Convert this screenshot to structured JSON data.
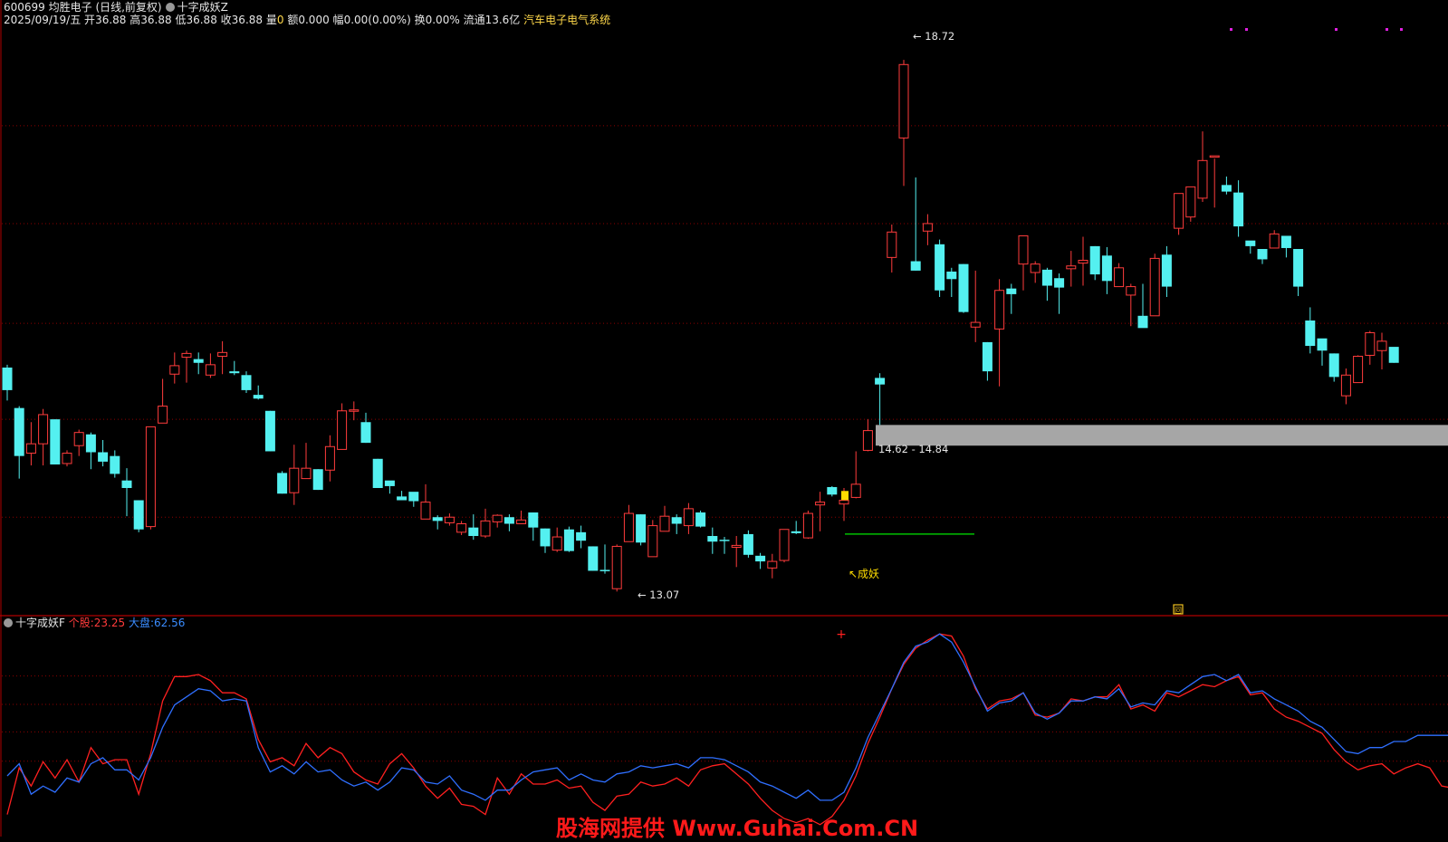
{
  "header": {
    "code_name": "600699 均胜电子 (日线,前复权)",
    "indicator_name": "十字成妖Z",
    "date_weekday": "2025/09/19/五",
    "open_label": "开",
    "open": "36.88",
    "high_label": "高",
    "high": "36.88",
    "low_label": "低",
    "low": "36.88",
    "close_label": "收",
    "close": "36.88",
    "vol_label": "量",
    "vol": "0",
    "amount_label": "额",
    "amount": "0.000",
    "change_label": "幅",
    "change": "0.00(0.00%)",
    "turnover_label": "换",
    "turnover": "0.00%",
    "float_label": "流通",
    "float_cap": "13.6亿",
    "sector": "汽车电子电气系统"
  },
  "annotations": {
    "high_label": "18.72",
    "low_label": "13.07",
    "zone_label": "14.62 - 14.84",
    "signal_label": "成妖",
    "panel_marker": "回"
  },
  "indicator_header": {
    "name": "十字成妖F",
    "stock_label": "个股:",
    "stock_value": "23.25",
    "market_label": "大盘:",
    "market_value": "62.56"
  },
  "watermark": "股海网提供 Www.Guhai.Com.CN",
  "colors": {
    "up": "#ff3c3c",
    "down": "#54f0f0",
    "zone": "#a6a6a6",
    "support_line": "#00c000",
    "signal": "#ffdd00",
    "stock_line": "#ff2020",
    "market_line": "#2f6fff",
    "grid": "#8b0000",
    "frame": "#b00000",
    "dots": "#e020e0"
  },
  "chart_data": [
    {
      "type": "candlestick",
      "price_range": [
        12.9,
        19.0
      ],
      "y_grid": [
        18.02,
        16.98,
        15.92,
        14.9,
        13.86
      ],
      "candles": [
        [
          15.45,
          15.21,
          15.48,
          15.1
        ],
        [
          15.02,
          14.51,
          15.04,
          14.27
        ],
        [
          14.54,
          14.64,
          14.87,
          14.41
        ],
        [
          14.64,
          14.95,
          15.01,
          14.41
        ],
        [
          14.9,
          14.42,
          14.9,
          14.42
        ],
        [
          14.43,
          14.54,
          14.57,
          14.4
        ],
        [
          14.62,
          14.76,
          14.79,
          14.51
        ],
        [
          14.74,
          14.55,
          14.76,
          14.37
        ],
        [
          14.55,
          14.45,
          14.68,
          14.4
        ],
        [
          14.51,
          14.32,
          14.57,
          14.28
        ],
        [
          14.25,
          14.17,
          14.38,
          13.87
        ],
        [
          14.04,
          13.73,
          14.04,
          13.7
        ],
        [
          13.76,
          14.82,
          14.82,
          13.73
        ],
        [
          14.86,
          15.04,
          15.33,
          14.86
        ],
        [
          15.38,
          15.47,
          15.61,
          15.28
        ],
        [
          15.56,
          15.6,
          15.63,
          15.29
        ],
        [
          15.54,
          15.5,
          15.61,
          15.38
        ],
        [
          15.37,
          15.48,
          15.6,
          15.34
        ],
        [
          15.57,
          15.61,
          15.73,
          15.38
        ],
        [
          15.41,
          15.39,
          15.52,
          15.37
        ],
        [
          15.37,
          15.21,
          15.41,
          15.18
        ],
        [
          15.16,
          15.12,
          15.26,
          15.11
        ],
        [
          14.99,
          14.56,
          14.99,
          14.56
        ],
        [
          14.33,
          14.11,
          14.35,
          14.11
        ],
        [
          14.12,
          14.38,
          14.63,
          13.99
        ],
        [
          14.27,
          14.38,
          14.65,
          14.27
        ],
        [
          14.37,
          14.15,
          14.37,
          14.15
        ],
        [
          14.36,
          14.61,
          14.73,
          14.24
        ],
        [
          14.58,
          14.99,
          15.07,
          14.58
        ],
        [
          14.99,
          15.0,
          15.09,
          14.89
        ],
        [
          14.87,
          14.65,
          14.97,
          14.65
        ],
        [
          14.48,
          14.17,
          14.48,
          14.17
        ],
        [
          14.25,
          14.19,
          14.24,
          14.11
        ],
        [
          14.08,
          14.04,
          14.14,
          14.06
        ],
        [
          14.13,
          14.03,
          14.1,
          13.97
        ],
        [
          13.84,
          14.02,
          14.21,
          13.84
        ],
        [
          13.86,
          13.82,
          13.88,
          13.73
        ],
        [
          13.8,
          13.86,
          13.9,
          13.77
        ],
        [
          13.7,
          13.79,
          13.82,
          13.67
        ],
        [
          13.75,
          13.66,
          13.89,
          13.62
        ],
        [
          13.66,
          13.82,
          13.95,
          13.64
        ],
        [
          13.81,
          13.88,
          13.89,
          13.75
        ],
        [
          13.86,
          13.79,
          13.89,
          13.71
        ],
        [
          13.79,
          13.83,
          13.93,
          13.79
        ],
        [
          13.91,
          13.75,
          13.91,
          13.61
        ],
        [
          13.74,
          13.55,
          13.74,
          13.48
        ],
        [
          13.51,
          13.65,
          13.75,
          13.49
        ],
        [
          13.73,
          13.5,
          13.76,
          13.49
        ],
        [
          13.7,
          13.61,
          13.77,
          13.53
        ],
        [
          13.55,
          13.29,
          13.55,
          13.29
        ],
        [
          13.3,
          13.29,
          13.57,
          13.26
        ],
        [
          13.1,
          13.55,
          13.57,
          13.07
        ],
        [
          13.6,
          13.9,
          13.99,
          13.6
        ],
        [
          13.89,
          13.59,
          13.89,
          13.56
        ],
        [
          13.44,
          13.77,
          13.83,
          13.44
        ],
        [
          13.71,
          13.87,
          13.98,
          13.71
        ],
        [
          13.86,
          13.79,
          13.89,
          13.68
        ],
        [
          13.77,
          13.95,
          14.01,
          13.68
        ],
        [
          13.91,
          13.76,
          13.93,
          13.75
        ],
        [
          13.66,
          13.6,
          13.75,
          13.47
        ],
        [
          13.62,
          13.61,
          13.65,
          13.47
        ],
        [
          13.54,
          13.56,
          13.66,
          13.33
        ],
        [
          13.68,
          13.46,
          13.72,
          13.43
        ],
        [
          13.45,
          13.39,
          13.48,
          13.31
        ],
        [
          13.32,
          13.39,
          13.47,
          13.21
        ],
        [
          13.4,
          13.73,
          13.73,
          13.38
        ],
        [
          13.71,
          13.69,
          13.82,
          13.68
        ],
        [
          13.64,
          13.9,
          13.93,
          13.63
        ],
        [
          13.99,
          14.02,
          14.13,
          13.71
        ],
        [
          14.18,
          14.1,
          14.19,
          14.08
        ],
        [
          14.0,
          14.04,
          14.17,
          13.82
        ],
        [
          14.07,
          14.21,
          14.56,
          14.06
        ],
        [
          14.57,
          14.78,
          14.9,
          14.56
        ],
        [
          15.34,
          15.27,
          15.39,
          14.84
        ],
        [
          16.62,
          16.89,
          16.97,
          16.46
        ],
        [
          17.89,
          18.67,
          18.72,
          17.38
        ],
        [
          16.58,
          16.48,
          17.47,
          16.48
        ],
        [
          16.9,
          16.98,
          17.08,
          16.75
        ],
        [
          16.76,
          16.27,
          16.81,
          16.2
        ],
        [
          16.47,
          16.39,
          16.51,
          16.2
        ],
        [
          16.55,
          16.04,
          16.55,
          16.03
        ],
        [
          15.88,
          15.93,
          16.48,
          15.72
        ],
        [
          15.72,
          15.41,
          15.72,
          15.31
        ],
        [
          15.86,
          16.27,
          16.39,
          15.25
        ],
        [
          16.29,
          16.23,
          16.34,
          16.02
        ],
        [
          16.55,
          16.85,
          16.81,
          16.27
        ],
        [
          16.46,
          16.55,
          16.58,
          16.35
        ],
        [
          16.49,
          16.32,
          16.51,
          16.16
        ],
        [
          16.4,
          16.3,
          16.45,
          16.02
        ],
        [
          16.5,
          16.53,
          16.69,
          16.31
        ],
        [
          16.56,
          16.59,
          16.84,
          16.32
        ],
        [
          16.74,
          16.44,
          16.74,
          16.38
        ],
        [
          16.64,
          16.37,
          16.73,
          16.23
        ],
        [
          16.31,
          16.51,
          16.56,
          16.42
        ],
        [
          16.22,
          16.31,
          16.34,
          15.89
        ],
        [
          16.0,
          15.87,
          16.34,
          15.89
        ],
        [
          16.0,
          16.61,
          16.66,
          16.0
        ],
        [
          16.65,
          16.31,
          16.74,
          16.2
        ],
        [
          16.93,
          17.3,
          17.3,
          16.86
        ],
        [
          17.05,
          17.37,
          17.35,
          17.0
        ],
        [
          17.25,
          17.65,
          17.96,
          17.21
        ],
        [
          17.7,
          17.7,
          17.67,
          17.15
        ],
        [
          17.39,
          17.32,
          17.48,
          17.29
        ],
        [
          17.31,
          16.95,
          17.44,
          16.84
        ],
        [
          16.8,
          16.74,
          16.77,
          16.66
        ],
        [
          16.71,
          16.6,
          16.71,
          16.55
        ],
        [
          16.72,
          16.87,
          16.91,
          16.72
        ],
        [
          16.85,
          16.72,
          16.83,
          16.62
        ],
        [
          16.71,
          16.31,
          16.71,
          16.21
        ],
        [
          15.95,
          15.68,
          16.09,
          15.6
        ],
        [
          15.76,
          15.63,
          15.73,
          15.47
        ],
        [
          15.6,
          15.35,
          15.6,
          15.3
        ],
        [
          15.15,
          15.37,
          15.44,
          15.06
        ],
        [
          15.29,
          15.57,
          15.58,
          15.29
        ],
        [
          15.58,
          15.82,
          15.84,
          15.48
        ],
        [
          15.63,
          15.73,
          15.82,
          15.43
        ],
        [
          15.67,
          15.5,
          15.63,
          15.5
        ]
      ]
    },
    {
      "type": "line",
      "y_range": [
        0,
        100
      ],
      "y_grid": [
        78.3,
        64.3,
        50.7,
        36.3
      ],
      "series": [
        {
          "name": "个股",
          "values": [
            10,
            33,
            24,
            36,
            28,
            37,
            26,
            43,
            35,
            37,
            37,
            20,
            40,
            66,
            78,
            78,
            79,
            76,
            70,
            70,
            67,
            47,
            36,
            38,
            34,
            45,
            38,
            43,
            40,
            31,
            27,
            25,
            35,
            40,
            33,
            24,
            18,
            23,
            15,
            14,
            10,
            28,
            20,
            30,
            25,
            25,
            27,
            23,
            24,
            16,
            12,
            19,
            20,
            26,
            24,
            25,
            28,
            24,
            32,
            34,
            35,
            30,
            25,
            18,
            12,
            8,
            6,
            8,
            5,
            9,
            17,
            29,
            45,
            58,
            72,
            84,
            92,
            96,
            99,
            98,
            88,
            72,
            62,
            66,
            67,
            70,
            59,
            58,
            60,
            67,
            66,
            68,
            68,
            74,
            62,
            64,
            61,
            70,
            68,
            71,
            74,
            73,
            76,
            78,
            69,
            70,
            62,
            58,
            56,
            53,
            50,
            42,
            36,
            32,
            34,
            35,
            30,
            33,
            35,
            33,
            24,
            23
          ]
        },
        {
          "name": "大盘",
          "values": [
            29,
            35,
            20,
            24,
            21,
            28,
            26,
            35,
            38,
            32,
            32,
            27,
            38,
            53,
            64,
            68,
            72,
            71,
            66,
            67,
            66,
            43,
            31,
            34,
            30,
            36,
            31,
            32,
            27,
            24,
            26,
            22,
            26,
            33,
            32,
            26,
            25,
            29,
            22,
            20,
            17,
            22,
            22,
            27,
            31,
            32,
            33,
            27,
            30,
            27,
            26,
            30,
            31,
            34,
            33,
            34,
            35,
            33,
            38,
            38,
            37,
            34,
            31,
            26,
            24,
            21,
            18,
            22,
            17,
            17,
            21,
            33,
            48,
            60,
            72,
            85,
            93,
            95,
            99,
            95,
            85,
            73,
            61,
            65,
            66,
            70,
            60,
            57,
            60,
            66,
            66,
            68,
            67,
            72,
            63,
            65,
            64,
            71,
            70,
            74,
            78,
            79,
            76,
            79,
            70,
            71,
            67,
            64,
            61,
            56,
            53,
            47,
            41,
            40,
            43,
            43,
            46,
            46,
            49,
            49,
            49,
            49
          ]
        }
      ]
    }
  ]
}
